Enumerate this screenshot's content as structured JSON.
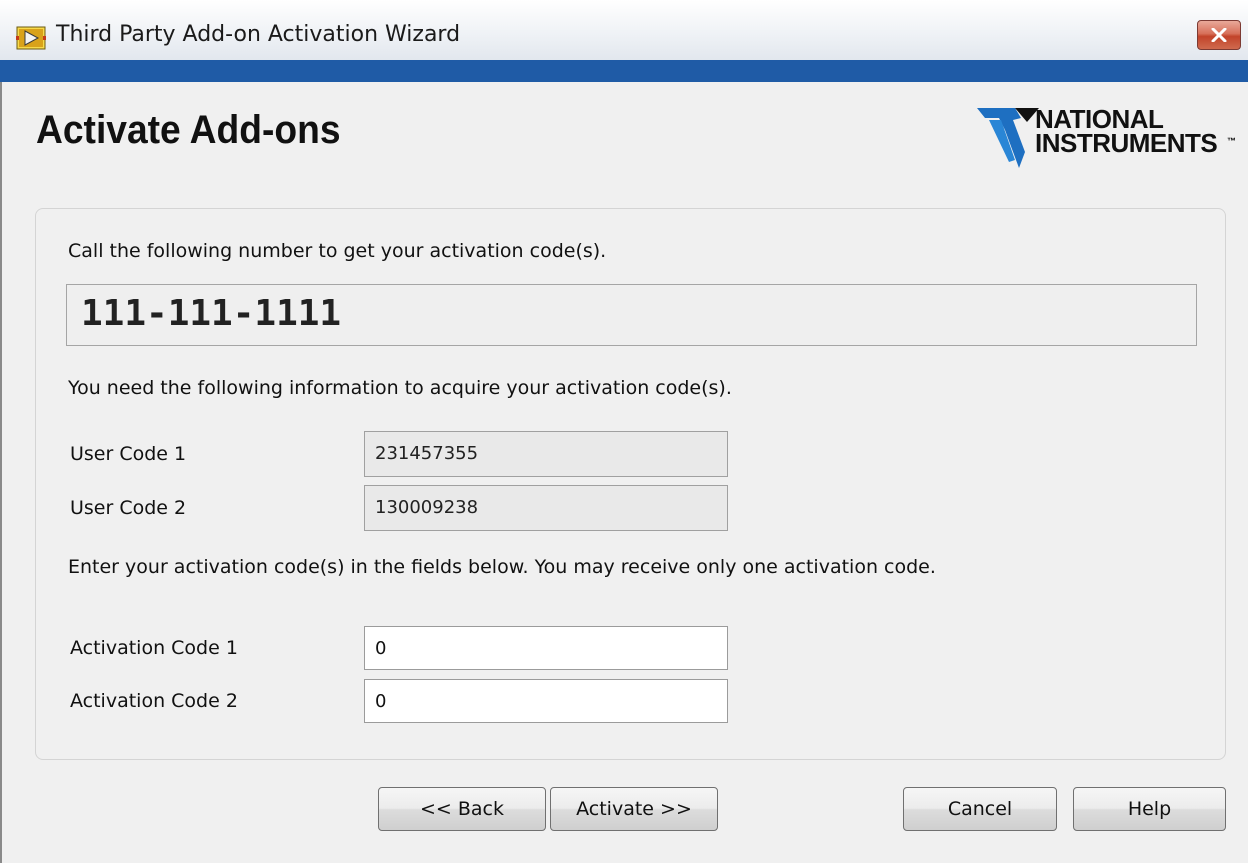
{
  "window": {
    "title": "Third Party Add-on Activation Wizard",
    "title_bar_accent": "#1f5ba6",
    "icons": [
      "labview-app-icon",
      "close-icon"
    ]
  },
  "header": {
    "page_title": "Activate Add-ons",
    "logo": {
      "line1": "NATIONAL",
      "line2": "INSTRUMENTS",
      "tm": "™",
      "icon": "ni-eagle-logo"
    }
  },
  "panel": {
    "call_instruction": "Call the following number to get your activation code(s).",
    "phone_number": "111-111-1111",
    "info_instruction": "You need the following information to acquire your activation code(s).",
    "user_codes": [
      {
        "label": "User Code 1",
        "value": "231457355"
      },
      {
        "label": "User Code 2",
        "value": "130009238"
      }
    ],
    "enter_instruction": "Enter your activation code(s) in the fields below. You may receive only one activation code.",
    "activation_codes": [
      {
        "label": "Activation Code 1",
        "value": "0"
      },
      {
        "label": "Activation Code 2",
        "value": "0"
      }
    ]
  },
  "buttons": {
    "back": "<< Back",
    "activate": "Activate >>",
    "cancel": "Cancel",
    "help": "Help"
  }
}
